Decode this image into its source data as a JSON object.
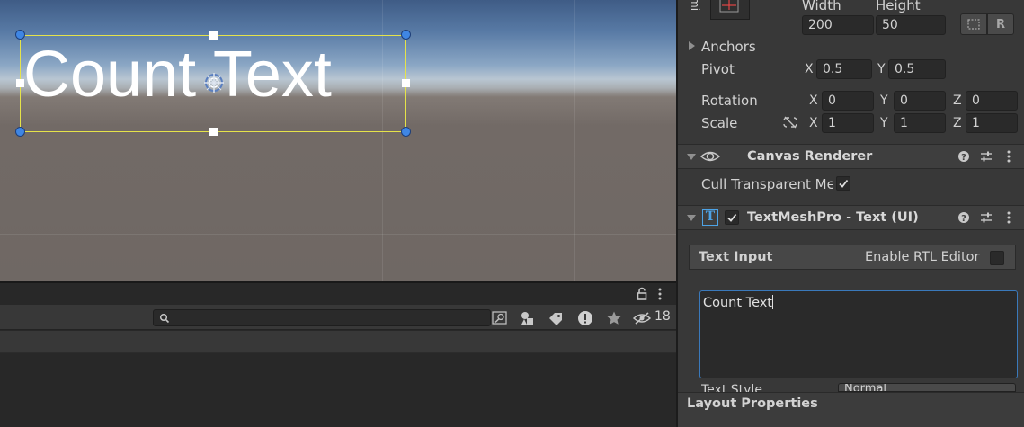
{
  "scene": {
    "selected_text": "Count Text"
  },
  "bottom_panel": {
    "search": {
      "value": "",
      "placeholder": ""
    },
    "hidden_count": "18"
  },
  "inspector": {
    "top_label": "mi",
    "width_label": "Width",
    "height_label": "Height",
    "width_value": "200",
    "height_value": "50",
    "anchors_label": "Anchors",
    "pivot": {
      "label": "Pivot",
      "x_label": "X",
      "y_label": "Y",
      "x": "0.5",
      "y": "0.5"
    },
    "rotation": {
      "label": "Rotation",
      "x_label": "X",
      "y_label": "Y",
      "z_label": "Z",
      "x": "0",
      "y": "0",
      "z": "0"
    },
    "scale": {
      "label": "Scale",
      "x_label": "X",
      "y_label": "Y",
      "z_label": "Z",
      "x": "1",
      "y": "1",
      "z": "1"
    },
    "canvas_renderer": {
      "title": "Canvas Renderer",
      "cull_label": "Cull Transparent Me:",
      "cull_checked": true
    },
    "textmeshpro": {
      "title": "TextMeshPro - Text (UI)",
      "enabled": true,
      "text_input_label": "Text Input",
      "rtl_label": "Enable RTL Editor",
      "text_value": "Count Text",
      "text_style_label": "Text Style",
      "text_style_value": "Normal"
    },
    "layout_properties_label": "Layout Properties"
  },
  "colors": {
    "selection_outline": "#e5e34a",
    "handle_blue": "#3f86e4",
    "panel_bg": "#383838",
    "field_bg": "#2a2a2a",
    "focus_border": "#3a79bb"
  }
}
